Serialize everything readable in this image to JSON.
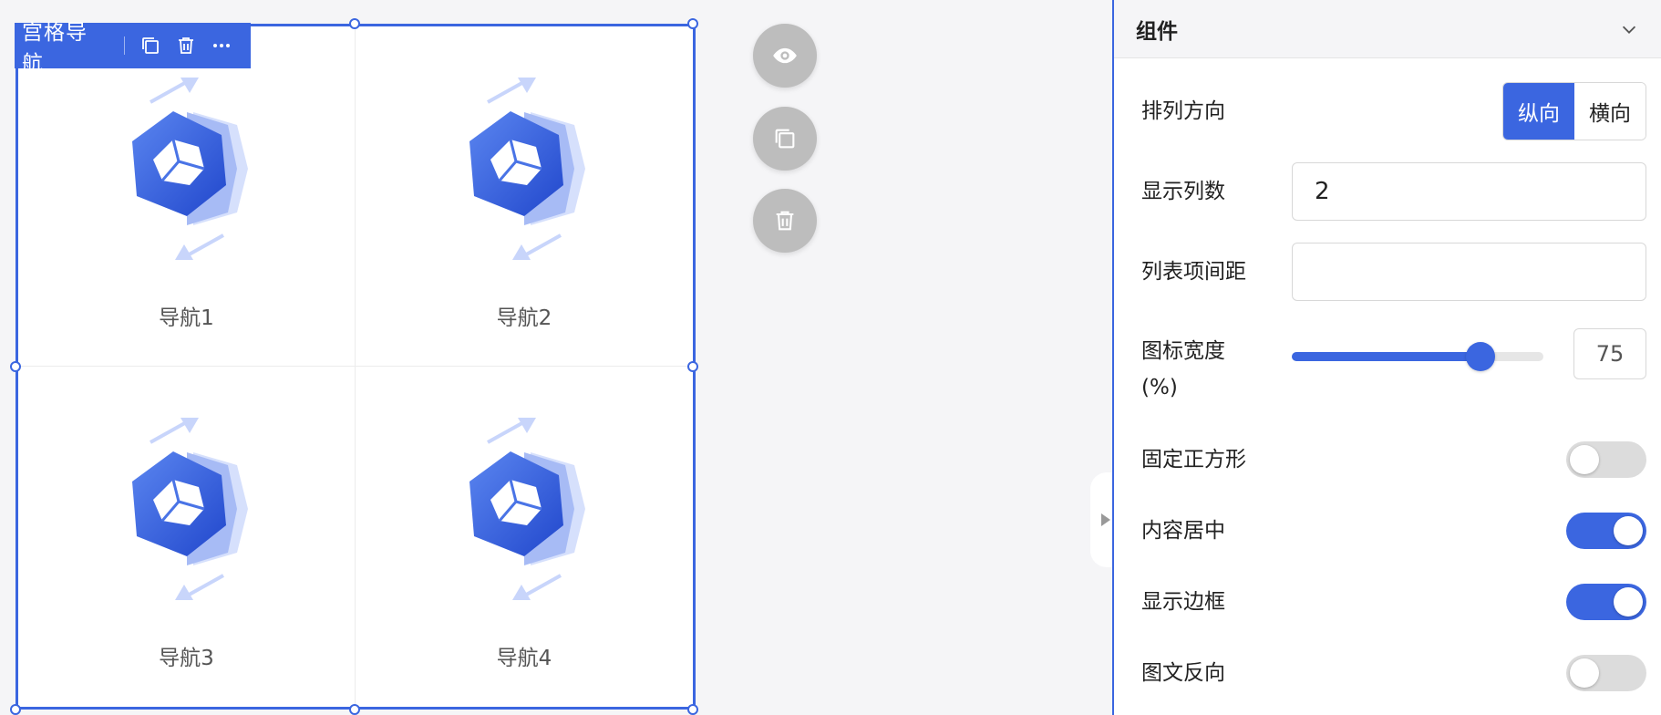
{
  "canvas": {
    "toolbar_title": "宫格导航",
    "items": [
      {
        "label": "导航1"
      },
      {
        "label": "导航2"
      },
      {
        "label": "导航3"
      },
      {
        "label": "导航4"
      }
    ]
  },
  "float_buttons": [
    {
      "icon": "eye-icon"
    },
    {
      "icon": "copy-icon"
    },
    {
      "icon": "trash-icon"
    }
  ],
  "panel": {
    "title": "组件",
    "arrange": {
      "label": "排列方向",
      "options": [
        "纵向",
        "横向"
      ],
      "selected": "纵向"
    },
    "columns": {
      "label": "显示列数",
      "value": "2"
    },
    "spacing": {
      "label": "列表项间距",
      "value": ""
    },
    "icon_width": {
      "label_line1": "图标宽度",
      "label_line2": "(%)",
      "value": "75",
      "fraction": 0.75
    },
    "square": {
      "label": "固定正方形",
      "on": false
    },
    "center": {
      "label": "内容居中",
      "on": true
    },
    "border": {
      "label": "显示边框",
      "on": true
    },
    "reverse": {
      "label": "图文反向",
      "on": false
    }
  },
  "colors": {
    "accent": "#3b66e0",
    "float_bg": "#bdbdbd"
  }
}
